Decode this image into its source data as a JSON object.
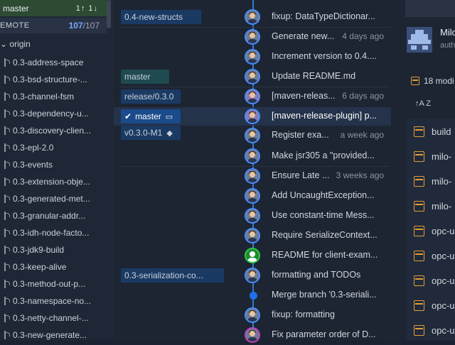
{
  "sidebar": {
    "current_branch": "master",
    "current_arrows": "1↑ 1↓",
    "remote_label": "EMOTE",
    "remote_count_a": "107",
    "remote_count_b": "/107",
    "origin_label": "origin",
    "branches": [
      "0.3-address-space",
      "0.3-bsd-structure-...",
      "0.3-channel-fsm",
      "0.3-dependency-u...",
      "0.3-discovery-clien...",
      "0.3-epl-2.0",
      "0.3-events",
      "0.3-extension-obje...",
      "0.3-generated-met...",
      "0.3-granular-addr...",
      "0.3-idh-node-facto...",
      "0.3-jdk9-build",
      "0.3-keep-alive",
      "0.3-method-out-p...",
      "0.3-namespace-no...",
      "0.3-netty-channel-...",
      "0.3-new-generate..."
    ]
  },
  "graph": {
    "tags": {
      "new_structs": "0.4-new-structs",
      "master_remote": "master",
      "release": "release/0.3.0",
      "master_current": "master",
      "tag_v030": "v0.3.0-M1",
      "serialization": "0.3-serialization-co..."
    },
    "commits": [
      {
        "msg": "fixup: DataTypeDictionar...",
        "date": ""
      },
      {
        "msg": "Generate new...",
        "date": "4 days ago"
      },
      {
        "msg": "Increment version to 0.4....",
        "date": ""
      },
      {
        "msg": "Update README.md",
        "date": ""
      },
      {
        "msg": "[maven-releas...",
        "date": "6 days ago"
      },
      {
        "msg": "[maven-release-plugin] p...",
        "date": ""
      },
      {
        "msg": "Register exa...",
        "date": "a week ago"
      },
      {
        "msg": "Make jsr305 a \"provided...",
        "date": ""
      },
      {
        "msg": "Ensure Late ...",
        "date": "3 weeks ago"
      },
      {
        "msg": "Add UncaughtException...",
        "date": ""
      },
      {
        "msg": "Use constant-time Mess...",
        "date": ""
      },
      {
        "msg": "Require SerializeContext...",
        "date": ""
      },
      {
        "msg": "README for client-exam...",
        "date": ""
      },
      {
        "msg": "formatting and TODOs",
        "date": ""
      },
      {
        "msg": "Merge branch '0.3-seriali...",
        "date": ""
      },
      {
        "msg": "fixup: formatting",
        "date": ""
      },
      {
        "msg": "Fix parameter order of D...",
        "date": ""
      }
    ]
  },
  "right": {
    "author_name": "Milo",
    "author_role": "auth",
    "modified": "18 modi",
    "sort_label": "↑A Z",
    "files": [
      "build",
      "milo-",
      "milo-",
      "milo-",
      "opc-u",
      "opc-u",
      "opc-u",
      "opc-u",
      "opc-u"
    ]
  },
  "colors": {
    "accent": "#1f6feb",
    "current_branch_bg": "#2d4a33",
    "file_icon": "#e39d3a"
  }
}
